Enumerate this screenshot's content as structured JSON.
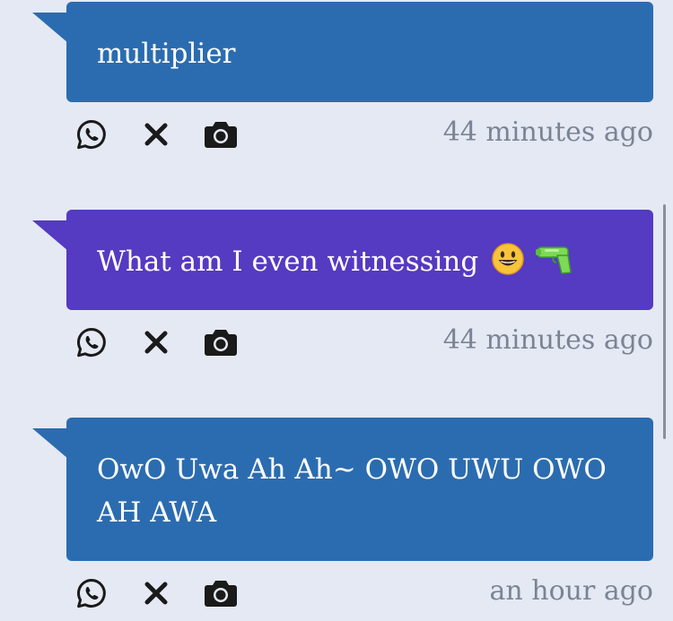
{
  "colors": {
    "background": "#e5e9f3",
    "bubble_blue": "#2b6cb0",
    "bubble_purple": "#553ac2",
    "timestamp": "#7b8494",
    "icon": "#1a1a1a"
  },
  "icons": [
    "whatsapp-icon",
    "close-icon",
    "camera-icon"
  ],
  "messages": [
    {
      "text": "multiplier",
      "time": "44 minutes ago",
      "color": "#2b6cb0"
    },
    {
      "text": "What am I even witnessing",
      "emojis": [
        "grinning-face-emoji",
        "water-pistol-emoji"
      ],
      "time": "44 minutes ago",
      "color": "#553ac2"
    },
    {
      "text": "OwO Uwa Ah Ah~ OWO UWU OWO AH AWA",
      "time": "an hour ago",
      "color": "#2b6cb0"
    }
  ]
}
